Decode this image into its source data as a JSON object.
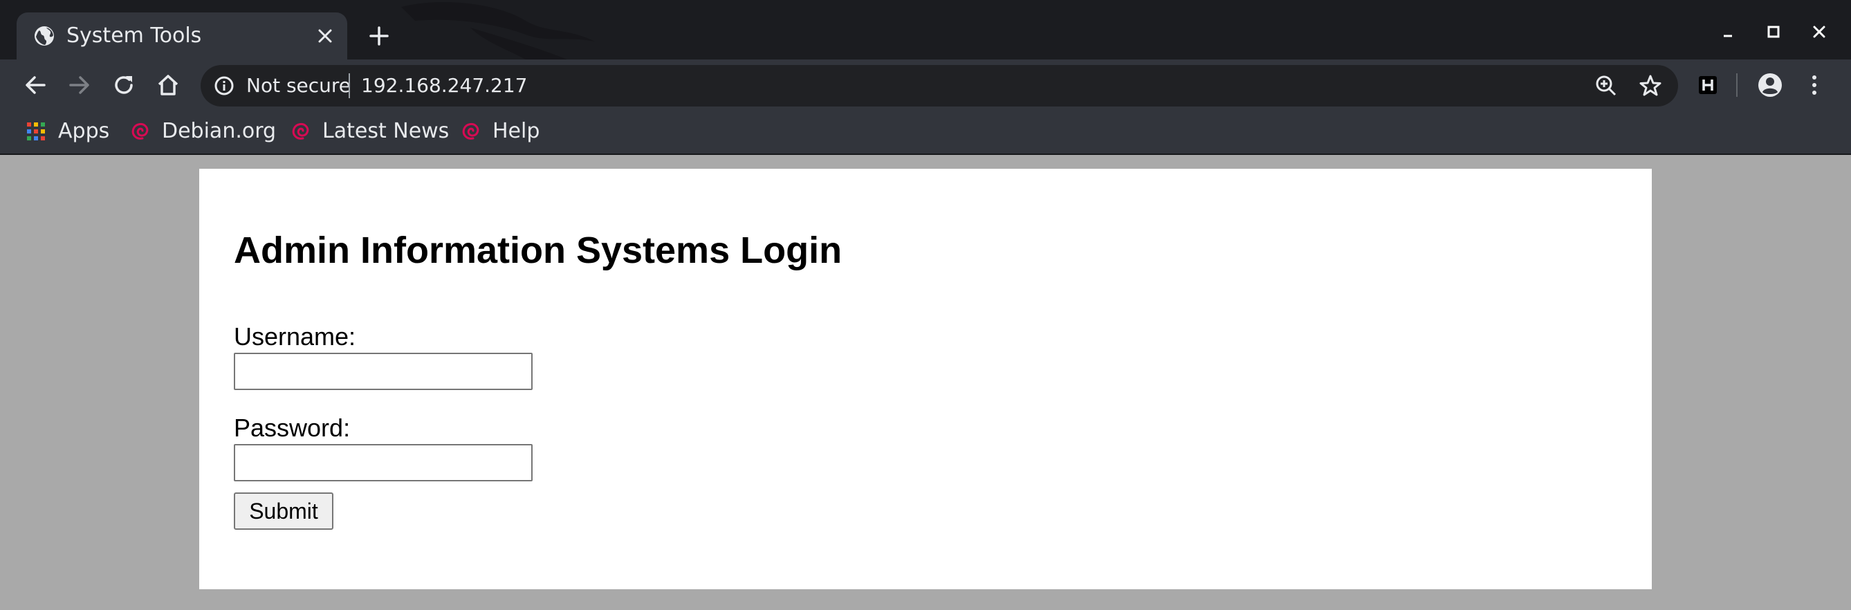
{
  "browser": {
    "tab_title": "System Tools",
    "security_label": "Not secure",
    "url": "192.168.247.217",
    "bookmarks": [
      {
        "label": "Apps"
      },
      {
        "label": "Debian.org"
      },
      {
        "label": "Latest News"
      },
      {
        "label": "Help"
      }
    ],
    "colors": {
      "frame": "#1b1c20",
      "toolbar": "#32353c",
      "omnibox": "#202124",
      "text": "#e8eaed",
      "debian_red": "#d70a53"
    },
    "icons": {
      "tab": "globe-icon",
      "toolbar": [
        "back-arrow-icon",
        "forward-arrow-icon",
        "reload-icon",
        "home-icon"
      ],
      "omnibox": [
        "info-icon",
        "zoom-icon",
        "star-icon"
      ],
      "extensions": [
        "extension-h-icon",
        "profile-icon",
        "more-vert-icon"
      ]
    }
  },
  "page": {
    "heading": "Admin Information Systems Login",
    "username_label": "Username:",
    "username_value": "",
    "password_label": "Password:",
    "password_value": "",
    "submit_label": "Submit",
    "colors": {
      "background": "#a9a9a9",
      "card": "#ffffff"
    }
  }
}
